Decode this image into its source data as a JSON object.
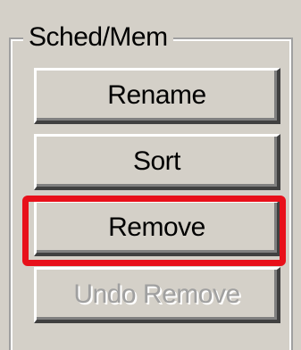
{
  "group": {
    "title": "Sched/Mem"
  },
  "buttons": {
    "rename": "Rename",
    "sort": "Sort",
    "remove": "Remove",
    "undo_remove": "Undo Remove"
  },
  "colors": {
    "highlight": "#e8101a",
    "background": "#d4d0c8",
    "disabled_text": "#a0a0a0"
  },
  "state": {
    "undo_remove_enabled": false,
    "highlighted_button": "Remove"
  }
}
